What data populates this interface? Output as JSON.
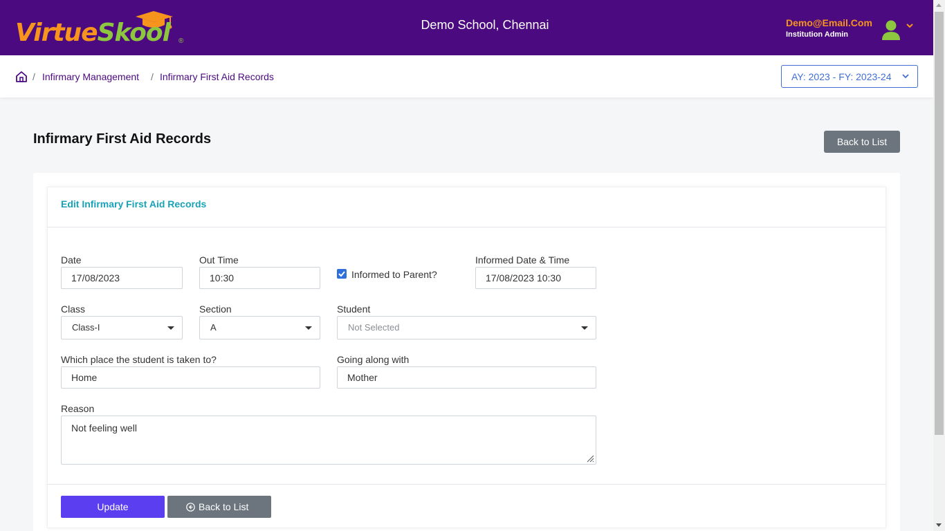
{
  "header": {
    "logo_part1": "Virtue",
    "logo_part2": "Skool",
    "logo_reg": "®",
    "school_name": "Demo School, Chennai",
    "user_email": "Demo@Email.Com",
    "user_role": "Institution Admin"
  },
  "breadcrumb": {
    "sep": "/",
    "items": [
      "Infirmary Management",
      "Infirmary First Aid Records"
    ]
  },
  "year_selector": "AY: 2023 - FY: 2023-24",
  "page": {
    "title": "Infirmary First Aid Records",
    "back_button": "Back to List"
  },
  "form": {
    "card_title": "Edit Infirmary First Aid Records",
    "date": {
      "label": "Date",
      "value": "17/08/2023"
    },
    "out_time": {
      "label": "Out Time",
      "value": "10:30"
    },
    "informed_parent": {
      "label": "Informed to Parent?",
      "checked": true
    },
    "informed_datetime": {
      "label": "Informed Date & Time",
      "value": "17/08/2023 10:30"
    },
    "class": {
      "label": "Class",
      "value": "Class-I"
    },
    "section": {
      "label": "Section",
      "value": "A"
    },
    "student": {
      "label": "Student",
      "value": "Not Selected"
    },
    "place": {
      "label": "Which place the student is taken to?",
      "value": "Home"
    },
    "going_with": {
      "label": "Going along with",
      "value": "Mother"
    },
    "reason": {
      "label": "Reason",
      "value": "Not feeling well"
    },
    "update_button": "Update",
    "back_button": "Back to List"
  },
  "colors": {
    "header_bg": "#4b0a80",
    "accent_orange": "#f7941d",
    "accent_green": "#8dc63f",
    "update_button": "#5b3ef0",
    "secondary_button": "#6c757d",
    "card_title": "#17a2b8"
  }
}
